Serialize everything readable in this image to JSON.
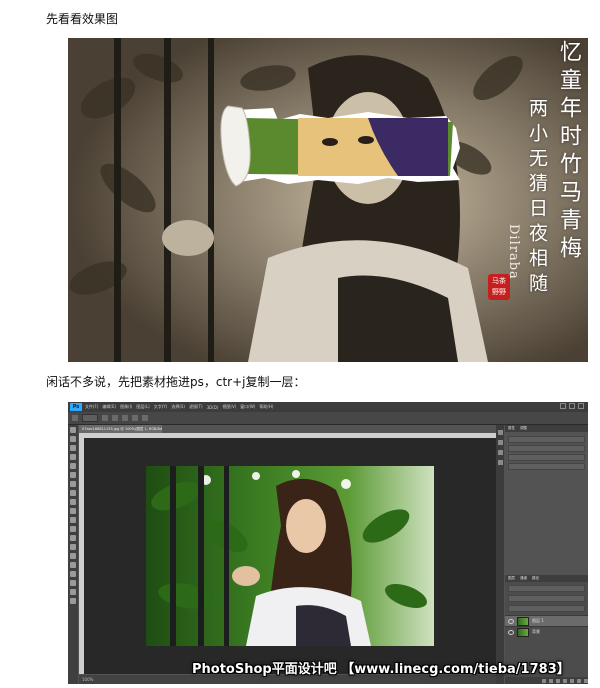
{
  "captions": {
    "effect": "先看看效果图",
    "step1": "闲话不多说，先把素材拖进ps，ctr+j复制一层："
  },
  "effect_image": {
    "title_line1": "忆童年时竹马青梅",
    "title_line2": "两小无猜日夜相随",
    "signature": "Dilraba",
    "seal": "马茶野野"
  },
  "photoshop": {
    "logo": "Ps",
    "menu": [
      "文件(F)",
      "编辑(E)",
      "图像(I)",
      "图层(L)",
      "文字(Y)",
      "选择(S)",
      "滤镜(T)",
      "3D(D)",
      "视图(V)",
      "窗口(W)",
      "帮助(H)"
    ],
    "doc_tab": "07aec168811155.jpg @ 100%(图层 1, RGB/8#)",
    "status": "100%",
    "panels": {
      "properties": "属性",
      "adjust": "调整",
      "layers_tab": "图层",
      "channels_tab": "通道",
      "paths_tab": "路径"
    },
    "layers": [
      {
        "name": "图层 1"
      },
      {
        "name": "背景"
      }
    ]
  },
  "watermark": "PhotoShop平面设计吧 【www.linecg.com/tieba/1783】"
}
